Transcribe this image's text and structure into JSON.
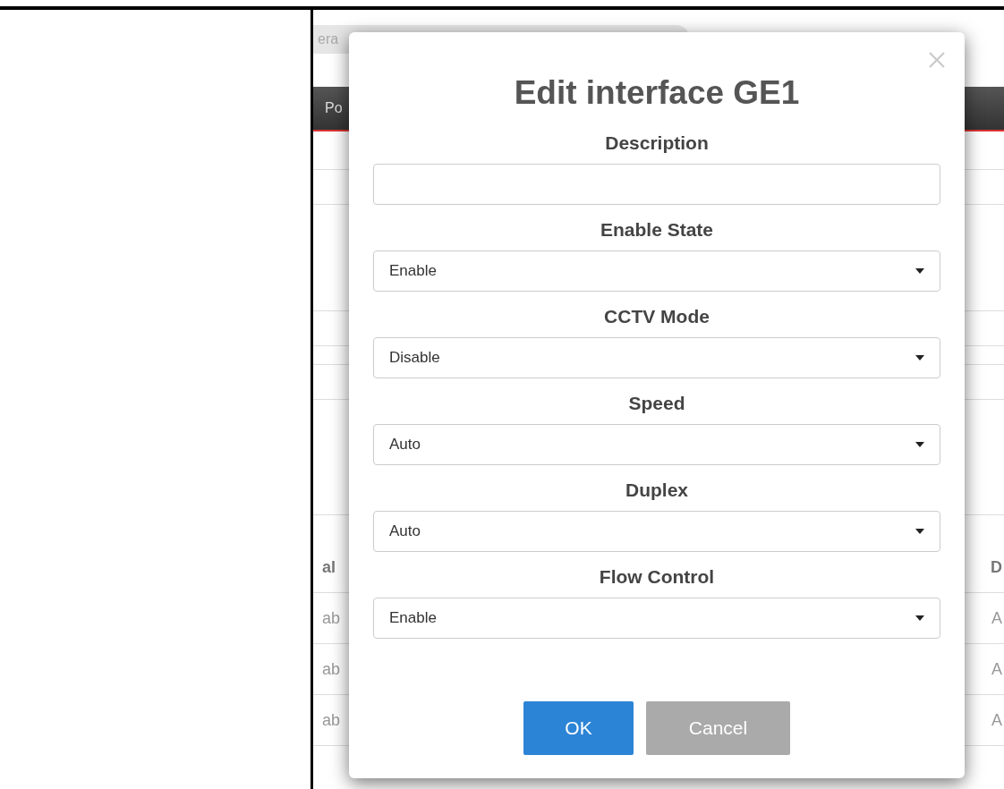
{
  "background": {
    "tabs": [
      {
        "label": "era"
      }
    ],
    "section_tab": {
      "label": "Po"
    },
    "table": {
      "header": [
        "al",
        "D"
      ],
      "rows": [
        [
          "ab",
          "A"
        ],
        [
          "ab",
          "A"
        ],
        [
          "ab",
          "A"
        ]
      ]
    }
  },
  "dialog": {
    "title": "Edit interface GE1",
    "fields": [
      {
        "label": "Description",
        "kind": "text"
      },
      {
        "label": "Enable State",
        "kind": "select",
        "value": "Enable"
      },
      {
        "label": "CCTV Mode",
        "kind": "select",
        "value": "Disable"
      },
      {
        "label": "Speed",
        "kind": "select",
        "value": "Auto"
      },
      {
        "label": "Duplex",
        "kind": "select",
        "value": "Auto"
      },
      {
        "label": "Flow Control",
        "kind": "select",
        "value": "Enable"
      }
    ],
    "buttons": [
      {
        "label": "OK",
        "kind": "primary"
      },
      {
        "label": "Cancel",
        "kind": "secondary"
      }
    ]
  }
}
